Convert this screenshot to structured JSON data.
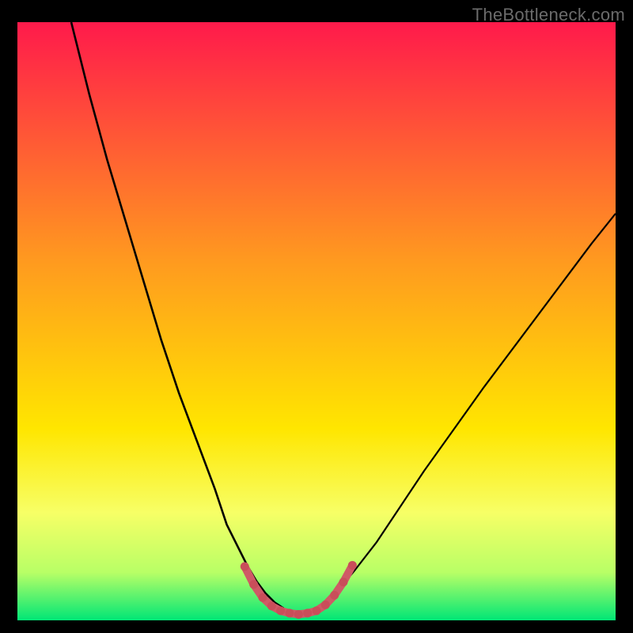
{
  "watermark": "TheBottleneck.com",
  "chart_data": {
    "type": "line",
    "title": "",
    "xlabel": "",
    "ylabel": "",
    "xlim": [
      0,
      100
    ],
    "ylim": [
      0,
      100
    ],
    "grid": false,
    "legend": false,
    "background_gradient": {
      "top_color": "#ff1a4b",
      "mid_color": "#ffe600",
      "bottom_color": "#00e676",
      "stops": [
        {
          "offset": 0.0,
          "color": "#ff1a4b"
        },
        {
          "offset": 0.4,
          "color": "#ff9a1f"
        },
        {
          "offset": 0.68,
          "color": "#ffe600"
        },
        {
          "offset": 0.82,
          "color": "#f7ff66"
        },
        {
          "offset": 0.92,
          "color": "#b8ff66"
        },
        {
          "offset": 1.0,
          "color": "#00e676"
        }
      ]
    },
    "series": [
      {
        "name": "curve-left",
        "color": "#000000",
        "width": 2.6,
        "x": [
          9,
          12,
          15,
          18,
          21,
          24,
          27,
          30,
          33,
          35,
          37,
          38.5,
          40,
          41.5,
          43,
          44.5
        ],
        "y": [
          100,
          88,
          77,
          67,
          57,
          47,
          38,
          30,
          22,
          16,
          12,
          9,
          6.5,
          4.5,
          3,
          2
        ]
      },
      {
        "name": "curve-right",
        "color": "#000000",
        "width": 2.2,
        "x": [
          50.5,
          52,
          54,
          56.5,
          60,
          64,
          68,
          73,
          78,
          84,
          90,
          96,
          100
        ],
        "y": [
          2,
          3.2,
          5.5,
          8.5,
          13,
          19,
          25,
          32,
          39,
          47,
          55,
          63,
          68
        ]
      },
      {
        "name": "trough",
        "color": "#cf5a66",
        "width": 10,
        "linecap": "round",
        "x": [
          38,
          39.5,
          41,
          42.5,
          44,
          45.5,
          47,
          48.5,
          50,
          51.5,
          53,
          54.5,
          56
        ],
        "y": [
          9,
          6,
          3.8,
          2.4,
          1.6,
          1.2,
          1.0,
          1.2,
          1.6,
          2.6,
          4.2,
          6.4,
          9.2
        ]
      }
    ],
    "markers": {
      "name": "trough-dots",
      "color": "#c94e5a",
      "radius": 5.5,
      "x": [
        38,
        39.5,
        41,
        42.5,
        44,
        45.5,
        47,
        48.5,
        50,
        51.5,
        53,
        54.5,
        56
      ],
      "y": [
        9,
        6,
        3.8,
        2.4,
        1.6,
        1.2,
        1.0,
        1.2,
        1.6,
        2.6,
        4.2,
        6.4,
        9.2
      ]
    }
  }
}
